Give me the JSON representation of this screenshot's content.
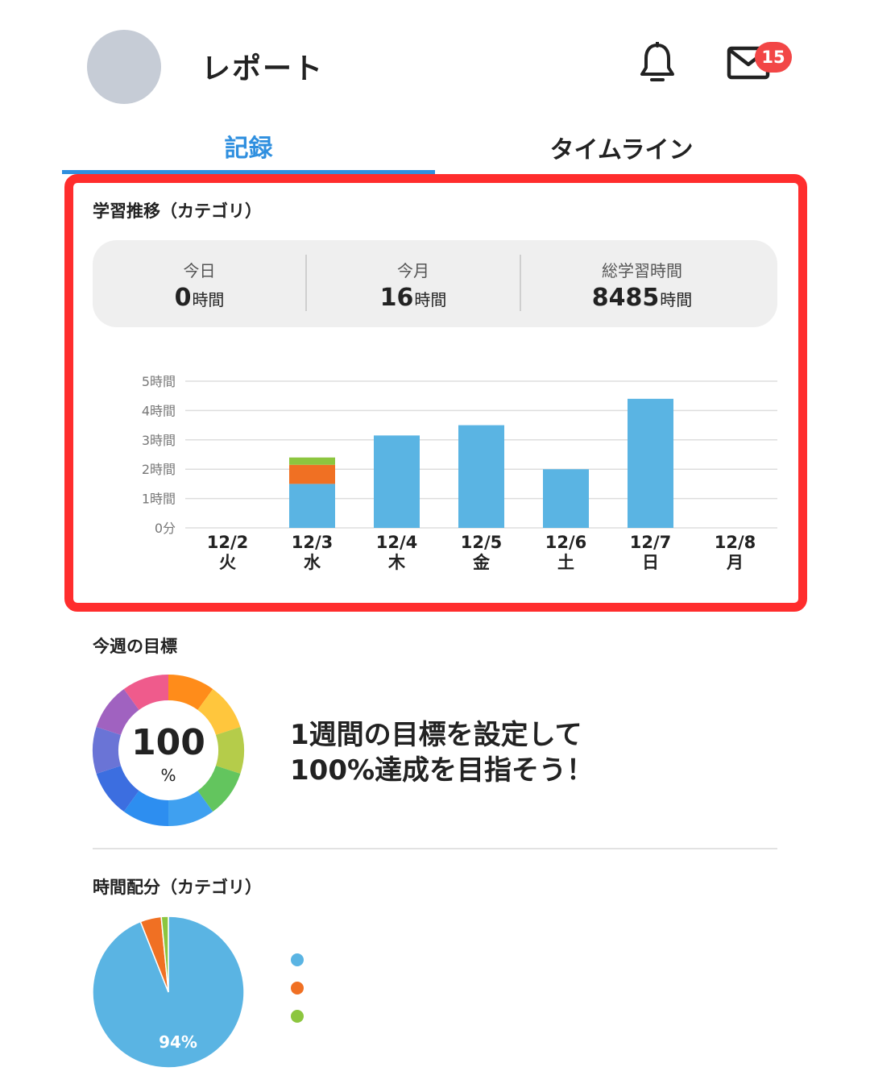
{
  "header": {
    "title": "レポート",
    "mail_badge": "15"
  },
  "tabs": [
    {
      "label": "記録",
      "active": true
    },
    {
      "label": "タイムライン",
      "active": false
    }
  ],
  "learning_trend": {
    "title": "学習推移（カテゴリ）",
    "stats": [
      {
        "label": "今日",
        "value": "0",
        "unit": "時間"
      },
      {
        "label": "今月",
        "value": "16",
        "unit": "時間"
      },
      {
        "label": "総学習時間",
        "value": "8485",
        "unit": "時間"
      }
    ]
  },
  "chart_data": [
    {
      "type": "bar",
      "stacked": true,
      "categories": [
        "12/2",
        "12/3",
        "12/4",
        "12/5",
        "12/6",
        "12/7",
        "12/8"
      ],
      "weekdays": [
        "火",
        "水",
        "木",
        "金",
        "土",
        "日",
        "月"
      ],
      "y_ticks": [
        "0分",
        "1時間",
        "2時間",
        "3時間",
        "4時間",
        "5時間"
      ],
      "ylim": [
        0,
        5
      ],
      "grid": true,
      "series": [
        {
          "color": "#5ab4e3",
          "values": [
            0,
            1.5,
            3.15,
            3.5,
            2.0,
            4.4,
            0
          ]
        },
        {
          "color": "#f07023",
          "values": [
            0,
            0.65,
            0,
            0,
            0,
            0,
            0
          ]
        },
        {
          "color": "#8cc63f",
          "values": [
            0,
            0.25,
            0,
            0,
            0,
            0,
            0
          ]
        }
      ]
    },
    {
      "type": "pie",
      "slices": [
        {
          "value": 94,
          "label": "94%",
          "color": "#5ab4e3"
        },
        {
          "value": 4.5,
          "label": "",
          "color": "#f07023"
        },
        {
          "value": 1.5,
          "label": "",
          "color": "#8cc63f"
        }
      ]
    }
  ],
  "weekly_goal": {
    "title": "今週の目標",
    "percent": "100",
    "percent_unit": "%",
    "message_line1": "1週間の目標を設定して",
    "message_line2": "100%達成を目指そう！",
    "ring_colors": [
      "#ff8c1a",
      "#ffc63d",
      "#b5cc4a",
      "#63c55e",
      "#3fa0f0",
      "#2d8ef0",
      "#3c6ee0",
      "#6a74d6",
      "#a062c0",
      "#ef5b8c"
    ]
  },
  "time_distribution": {
    "title": "時間配分（カテゴリ）"
  }
}
